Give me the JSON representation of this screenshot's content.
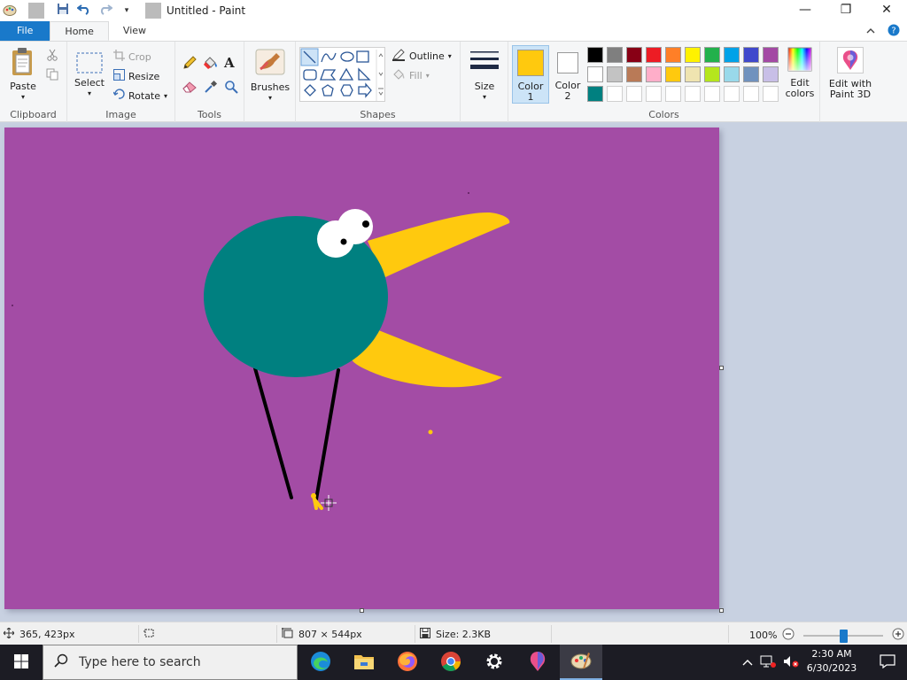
{
  "window": {
    "title": "Untitled - Paint",
    "minimize": "—",
    "restore": "❐",
    "close": "✕"
  },
  "tabs": {
    "file": "File",
    "home": "Home",
    "view": "View"
  },
  "ribbon": {
    "clipboard": {
      "label": "Clipboard",
      "paste": "Paste"
    },
    "image": {
      "label": "Image",
      "select": "Select",
      "crop": "Crop",
      "resize": "Resize",
      "rotate": "Rotate"
    },
    "tools": {
      "label": "Tools"
    },
    "brushes": {
      "label": "Brushes"
    },
    "shapes": {
      "label": "Shapes",
      "outline": "Outline",
      "fill": "Fill"
    },
    "size": {
      "label": "Size"
    },
    "colors": {
      "label": "Colors",
      "color1": "Color",
      "color1_num": "1",
      "color2": "Color",
      "color2_num": "2",
      "color1_value": "#ffc90e",
      "color2_value": "#ffffff",
      "edit": "Edit",
      "edit2": "colors",
      "palette": [
        "#000000",
        "#7f7f7f",
        "#880015",
        "#ed1c24",
        "#ff7f27",
        "#fff200",
        "#22b14c",
        "#00a2e8",
        "#3f48cc",
        "#a349a4",
        "#ffffff",
        "#c3c3c3",
        "#b97a57",
        "#ffaec9",
        "#ffc90e",
        "#efe4b0",
        "#b5e61d",
        "#99d9ea",
        "#7092be",
        "#c8bfe7",
        "#008080",
        "#ffffff",
        "#ffffff",
        "#ffffff",
        "#ffffff",
        "#ffffff",
        "#ffffff",
        "#ffffff",
        "#ffffff",
        "#ffffff"
      ]
    },
    "paint3d": {
      "line1": "Edit with",
      "line2": "Paint 3D"
    }
  },
  "canvas": {
    "background": "#a34ca5",
    "body_color": "#008080",
    "beak_color": "#ffc90e"
  },
  "status": {
    "cursor_pos": "365, 423px",
    "dimensions": "807 × 544px",
    "size": "Size: 2.3KB",
    "zoom": "100%",
    "zoom_fraction": 0.5
  },
  "taskbar": {
    "search_placeholder": "Type here to search",
    "time": "2:30 AM",
    "date": "6/30/2023"
  }
}
